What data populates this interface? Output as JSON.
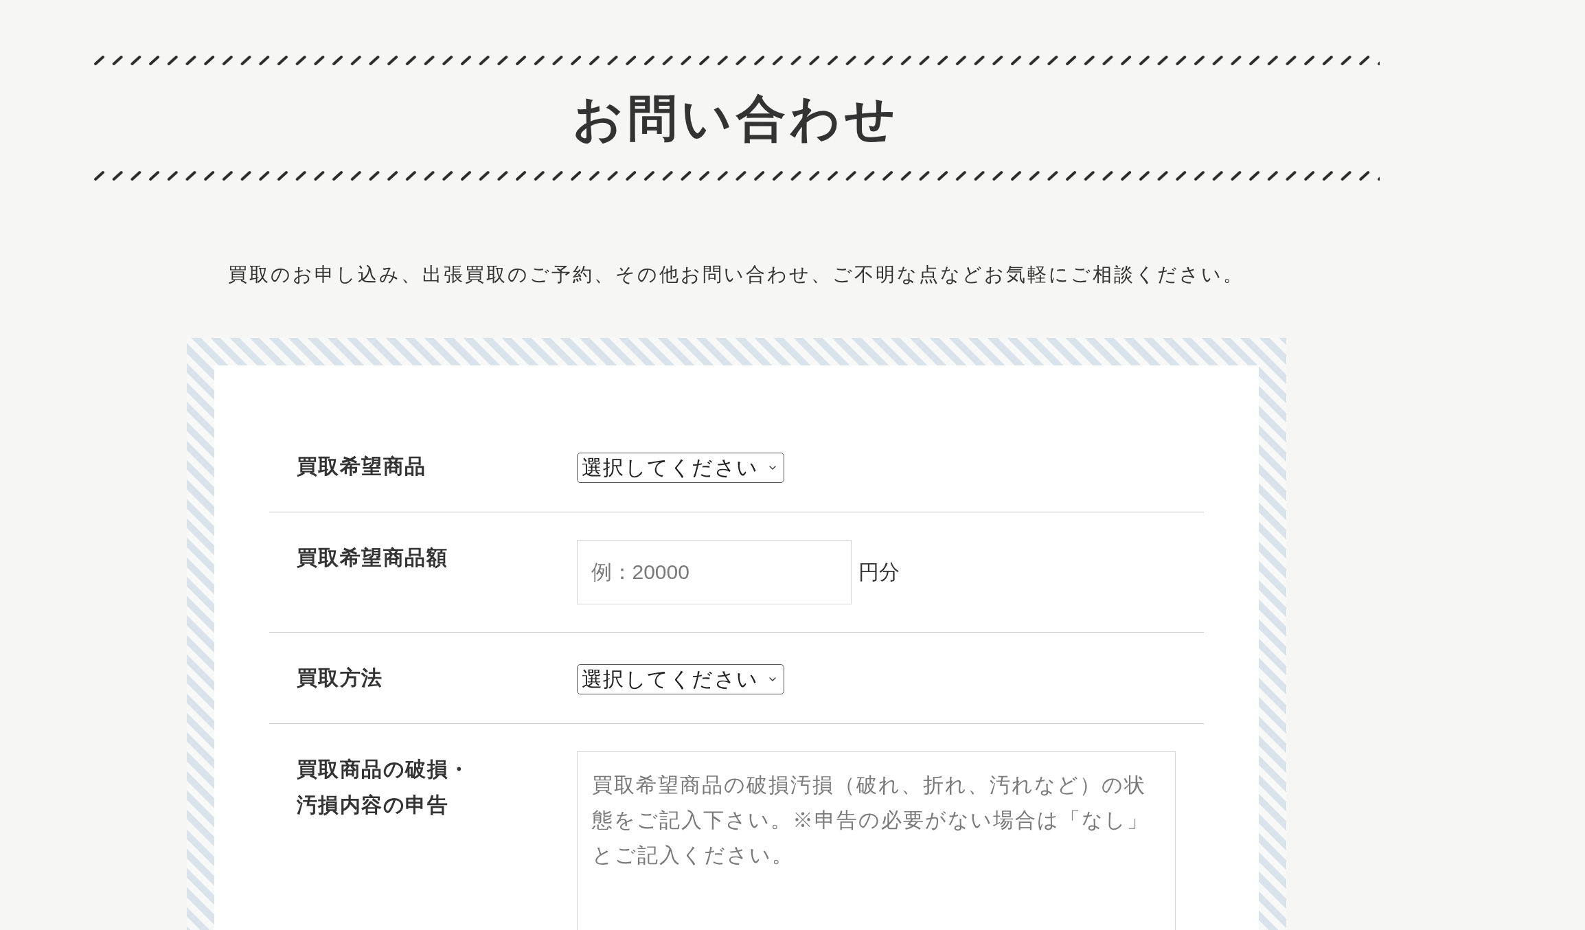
{
  "header": {
    "title": "お問い合わせ"
  },
  "intro": "買取のお申し込み、出張買取のご予約、その他お問い合わせ、ご不明な点などお気軽にご相談ください。",
  "form": {
    "rows": [
      {
        "kind": "select",
        "label": "買取希望商品",
        "value": "選択してください"
      },
      {
        "kind": "text",
        "label": "買取希望商品額",
        "placeholder": "例：20000",
        "unit": "円分"
      },
      {
        "kind": "select",
        "label": "買取方法",
        "value": "選択してください"
      },
      {
        "kind": "textarea",
        "label": "買取商品の破損・汚損内容の申告",
        "placeholder": "買取希望商品の破損汚損（破れ、折れ、汚れなど）の状態をご記入下さい。※申告の必要がない場合は「なし」とご記入ください。"
      }
    ]
  }
}
